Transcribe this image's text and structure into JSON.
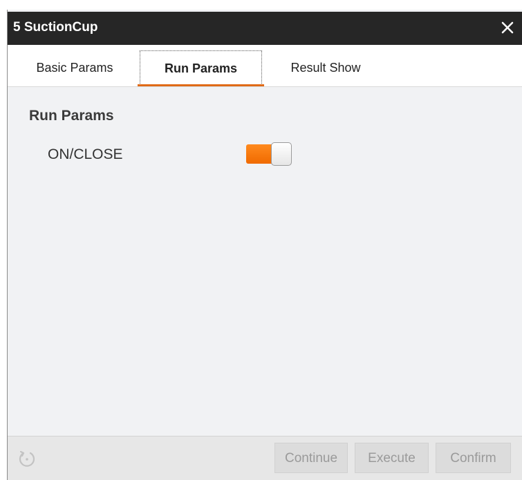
{
  "window": {
    "title": "5 SuctionCup"
  },
  "tabs": [
    {
      "label": "Basic Params",
      "active": false
    },
    {
      "label": "Run Params",
      "active": true
    },
    {
      "label": "Result Show",
      "active": false
    }
  ],
  "run_params": {
    "section_title": "Run Params",
    "fields": [
      {
        "label": "ON/CLOSE",
        "type": "toggle",
        "value": "on",
        "accent_color": "#f27a10"
      }
    ]
  },
  "footer": {
    "refresh_icon": "refresh-icon",
    "buttons": [
      {
        "label": "Continue"
      },
      {
        "label": "Execute"
      },
      {
        "label": "Confirm"
      }
    ]
  },
  "colors": {
    "titlebar_bg": "#262626",
    "accent": "#e06a17",
    "panel_bg": "#f1f2f4"
  }
}
